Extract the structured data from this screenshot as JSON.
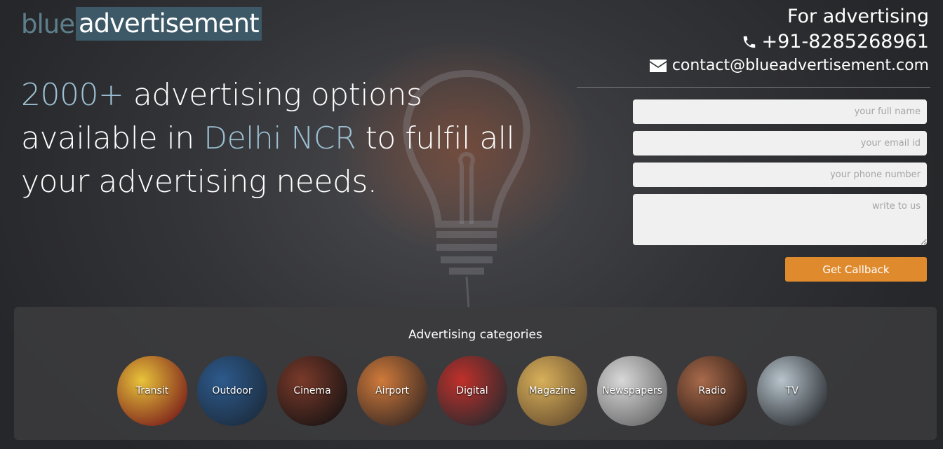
{
  "logo": {
    "part1": "blue",
    "part2": "advertisement"
  },
  "contact": {
    "heading": "For advertising",
    "phone": "+91-8285268961",
    "email": "contact@blueadvertisement.com",
    "phone_icon": "phone-icon",
    "email_icon": "envelope-icon"
  },
  "headline": {
    "highlight1": "2000+",
    "text1": " advertising options available in ",
    "highlight2": "Delhi NCR",
    "text2": " to fulfil all your advertising needs."
  },
  "form": {
    "name_placeholder": "your full name",
    "email_placeholder": "your email id",
    "phone_placeholder": "your phone number",
    "message_placeholder": "write to us",
    "submit_label": "Get Callback"
  },
  "categories": {
    "title": "Advertising categories",
    "items": [
      {
        "label": "Transit",
        "color1": "#e8c33a",
        "color2": "#7a1d1a"
      },
      {
        "label": "Outdoor",
        "color1": "#2d5a8c",
        "color2": "#1c2c3e"
      },
      {
        "label": "Cinema",
        "color1": "#7a3a2a",
        "color2": "#1a1414"
      },
      {
        "label": "Airport",
        "color1": "#d07a3a",
        "color2": "#3a2a24"
      },
      {
        "label": "Digital",
        "color1": "#c0302a",
        "color2": "#2a2a2e"
      },
      {
        "label": "Magazine",
        "color1": "#d8b05a",
        "color2": "#6a5030"
      },
      {
        "label": "Newspapers",
        "color1": "#d8d8d8",
        "color2": "#6a6a6a"
      },
      {
        "label": "Radio",
        "color1": "#a86a4a",
        "color2": "#2a1a16"
      },
      {
        "label": "TV",
        "color1": "#b8c4cc",
        "color2": "#2a2e32"
      }
    ]
  }
}
